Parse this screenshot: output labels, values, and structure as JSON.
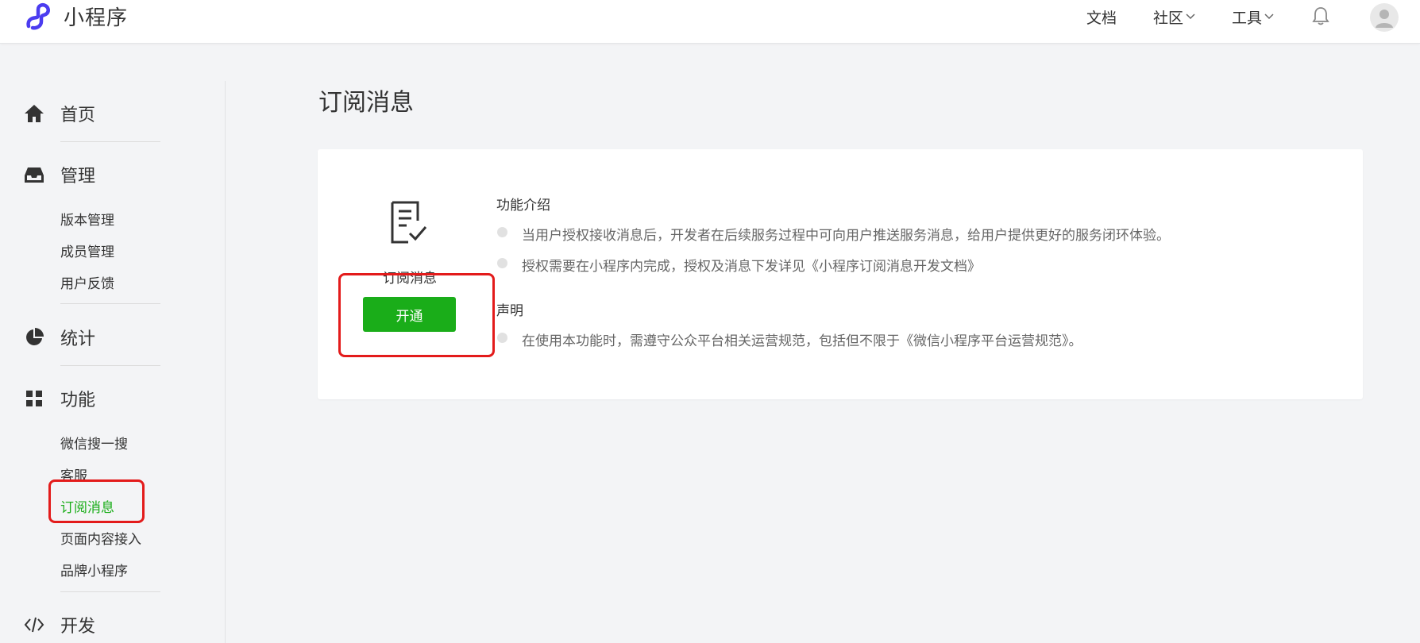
{
  "header": {
    "logo_text": "小程序",
    "nav": [
      {
        "label": "文档"
      },
      {
        "label": "社区"
      },
      {
        "label": "工具"
      }
    ],
    "colors": {
      "brand": "#4b3cf0",
      "accent": "#1aad19",
      "highlight": "#e31b1b"
    }
  },
  "sidebar": {
    "sections": [
      {
        "label": "首页",
        "icon": "home-icon"
      },
      {
        "label": "管理",
        "icon": "inbox-icon",
        "items": [
          "版本管理",
          "成员管理",
          "用户反馈"
        ]
      },
      {
        "label": "统计",
        "icon": "pie-chart-icon"
      },
      {
        "label": "功能",
        "icon": "grid-icon",
        "items": [
          "微信搜一搜",
          "客服",
          "订阅消息",
          "页面内容接入",
          "品牌小程序"
        ]
      },
      {
        "label": "开发",
        "icon": "code-icon"
      }
    ],
    "active_item": "订阅消息"
  },
  "main": {
    "title": "订阅消息",
    "feature": {
      "name": "订阅消息",
      "icon": "document-check-icon",
      "button_label": "开通"
    },
    "intro": {
      "title": "功能介绍",
      "items": [
        "当用户授权接收消息后，开发者在后续服务过程中可向用户推送服务消息，给用户提供更好的服务闭环体验。",
        "授权需要在小程序内完成，授权及消息下发详见《小程序订阅消息开发文档》"
      ]
    },
    "statement": {
      "title": "声明",
      "items": [
        "在使用本功能时，需遵守公众平台相关运营规范，包括但不限于《微信小程序平台运营规范》。"
      ]
    }
  }
}
